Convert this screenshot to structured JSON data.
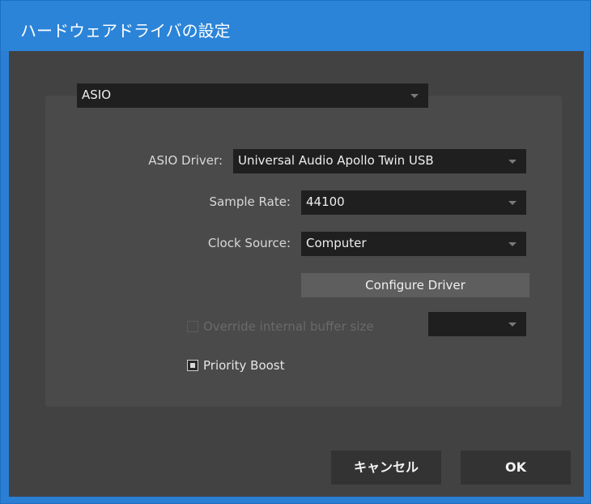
{
  "window": {
    "title": "ハードウェアドライバの設定"
  },
  "driver_type": {
    "value": "ASIO"
  },
  "asio_driver": {
    "label": "ASIO Driver:",
    "value": "Universal Audio Apollo Twin USB"
  },
  "sample_rate": {
    "label": "Sample Rate:",
    "value": "44100"
  },
  "clock_source": {
    "label": "Clock Source:",
    "value": "Computer"
  },
  "configure_driver": {
    "label": "Configure Driver"
  },
  "override_buffer": {
    "label": "Override internal buffer size",
    "checked": false,
    "enabled": false,
    "value": ""
  },
  "priority_boost": {
    "label": "Priority Boost",
    "checked": true
  },
  "footer": {
    "cancel_label": "キャンセル",
    "ok_label": "OK"
  },
  "colors": {
    "titlebar": "#2b84d8",
    "client_bg": "#424242",
    "panel_bg": "#4a4a4a",
    "combo_bg": "#1f1f1f",
    "button_bg": "#5e5e5e",
    "footer_button_bg": "#333333"
  }
}
